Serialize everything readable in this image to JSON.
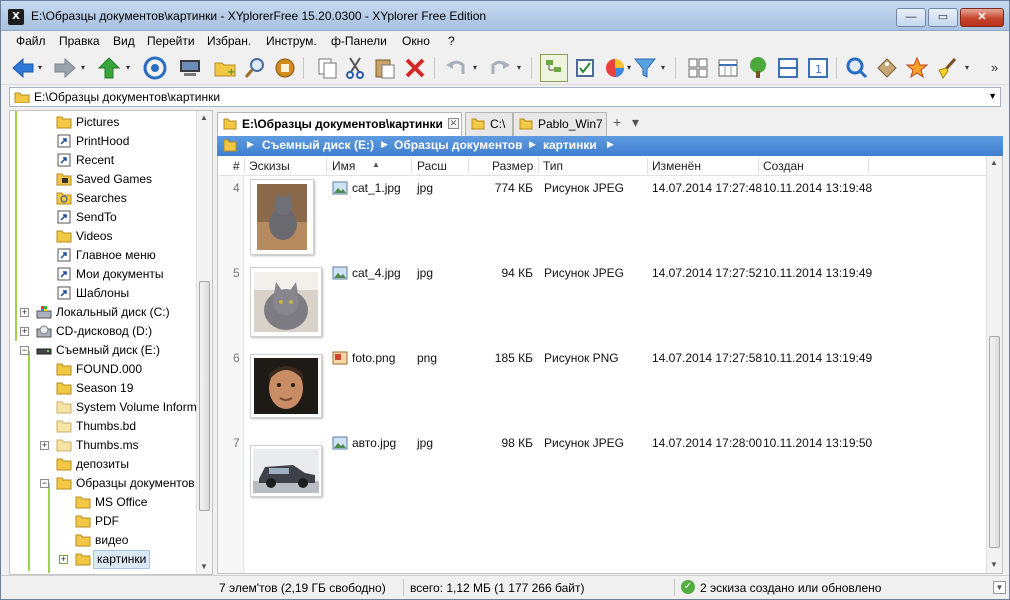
{
  "window": {
    "title": "E:\\Образцы документов\\картинки - XYplorerFree 15.20.0300 - XYplorer Free Edition",
    "logo": "X",
    "minimize": "—",
    "maximize": "▭",
    "close": "✕"
  },
  "menu": [
    "Файл",
    "Правка",
    "Вид",
    "Перейти",
    "Избран.",
    "Инструм.",
    "ф-Панели",
    "Окно",
    "?"
  ],
  "toolbar": {
    "icons": [
      "back-arrow-icon",
      "forward-arrow-icon",
      "up-arrow-icon",
      "target-icon",
      "monitor-icon",
      "new-folder-icon",
      "search-magnifier-icon",
      "coin-icon",
      "copy-icon",
      "cut-icon",
      "paste-icon",
      "delete-icon",
      "undo-icon",
      "redo-icon",
      "tree-toggle-icon",
      "checkbox-icon",
      "pie-chart-icon",
      "filter-icon",
      "layout-icon",
      "columns-icon",
      "tree-icon",
      "split-icon",
      "single-pane-icon",
      "find-icon",
      "tag-icon",
      "star-icon",
      "broom-icon"
    ],
    "overflow": "»"
  },
  "address": {
    "value": "E:\\Образцы документов\\картинки"
  },
  "tree": {
    "items": [
      {
        "label": "Pictures",
        "icon": "special-folder-icon"
      },
      {
        "label": "PrintHood",
        "icon": "shortcut-folder-icon"
      },
      {
        "label": "Recent",
        "icon": "shortcut-folder-icon"
      },
      {
        "label": "Saved Games",
        "icon": "special-folder-icon"
      },
      {
        "label": "Searches",
        "icon": "search-folder-icon"
      },
      {
        "label": "SendTo",
        "icon": "shortcut-folder-icon"
      },
      {
        "label": "Videos",
        "icon": "special-folder-icon"
      },
      {
        "label": "Главное меню",
        "icon": "shortcut-folder-icon"
      },
      {
        "label": "Мои документы",
        "icon": "shortcut-folder-icon"
      },
      {
        "label": "Шаблоны",
        "icon": "shortcut-folder-icon"
      },
      {
        "label": "Локальный диск (C:)",
        "icon": "windows-drive-icon"
      },
      {
        "label": "CD-дисковод (D:)",
        "icon": "cd-drive-icon"
      },
      {
        "label": "Съемный диск (E:)",
        "icon": "removable-drive-icon"
      },
      {
        "label": "FOUND.000",
        "icon": "folder-icon"
      },
      {
        "label": "Season 19",
        "icon": "folder-icon"
      },
      {
        "label": "System Volume Inform",
        "icon": "system-folder-icon"
      },
      {
        "label": "Thumbs.bd",
        "icon": "system-folder-icon"
      },
      {
        "label": "Thumbs.ms",
        "icon": "system-folder-icon"
      },
      {
        "label": "депозиты",
        "icon": "folder-icon"
      },
      {
        "label": "Образцы документов",
        "icon": "folder-icon"
      },
      {
        "label": "MS Office",
        "icon": "folder-icon"
      },
      {
        "label": "PDF",
        "icon": "folder-icon"
      },
      {
        "label": "видео",
        "icon": "folder-icon"
      },
      {
        "label": "картинки",
        "icon": "folder-icon"
      }
    ]
  },
  "tabs": [
    {
      "label": "E:\\Образцы документов\\картинки",
      "icon": "folder-icon"
    },
    {
      "label": "C:\\",
      "icon": "folder-icon"
    },
    {
      "label": "Pablo_Win7",
      "icon": "folder-icon"
    }
  ],
  "tab_add": "+",
  "tab_menu": "▾",
  "breadcrumb": [
    "Съемный диск (E:)",
    "Образцы документов",
    "картинки"
  ],
  "columns": {
    "num": "#",
    "thumbs": "Эскизы",
    "name": "Имя",
    "ext": "Расш",
    "size": "Размер",
    "type": "Тип",
    "modified": "Изменён",
    "created": "Создан"
  },
  "files": [
    {
      "num": "4",
      "name": "cat_1.jpg",
      "ext": "jpg",
      "size": "774 КБ",
      "type": "Рисунок JPEG",
      "modified": "14.07.2014 17:27:48",
      "created": "10.11.2014 13:19:48"
    },
    {
      "num": "5",
      "name": "cat_4.jpg",
      "ext": "jpg",
      "size": "94 КБ",
      "type": "Рисунок JPEG",
      "modified": "14.07.2014 17:27:52",
      "created": "10.11.2014 13:19:49"
    },
    {
      "num": "6",
      "name": "foto.png",
      "ext": "png",
      "size": "185 КБ",
      "type": "Рисунок PNG",
      "modified": "14.07.2014 17:27:58",
      "created": "10.11.2014 13:19:49"
    },
    {
      "num": "7",
      "name": "авто.jpg",
      "ext": "jpg",
      "size": "98 КБ",
      "type": "Рисунок JPEG",
      "modified": "14.07.2014 17:28:00",
      "created": "10.11.2014 13:19:50"
    }
  ],
  "status": {
    "items": "7 элем'тов (2,19 ГБ свободно)",
    "total": "всего: 1,12 МБ (1 177 266 байт)",
    "thumbs": "2 эскиза  создано или обновлено"
  },
  "colors": {
    "accent": "#3f7fcf",
    "tree_line": "#9fd34a",
    "folder": "#f2c744"
  }
}
